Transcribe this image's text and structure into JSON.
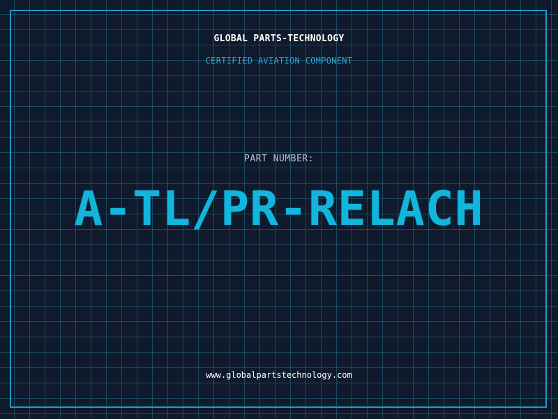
{
  "header": {
    "company_name": "GLOBAL PARTS-TECHNOLOGY",
    "tagline": "CERTIFIED AVIATION COMPONENT"
  },
  "main": {
    "part_number_label": "PART NUMBER:",
    "part_number_value": "A-TL/PR-RELACH"
  },
  "footer": {
    "website": "www.globalpartstechnology.com"
  },
  "colors": {
    "background": "#0f1a2c",
    "grid_line": "#286e8c",
    "accent": "#12b6dc",
    "frame": "#1f9cc4"
  }
}
